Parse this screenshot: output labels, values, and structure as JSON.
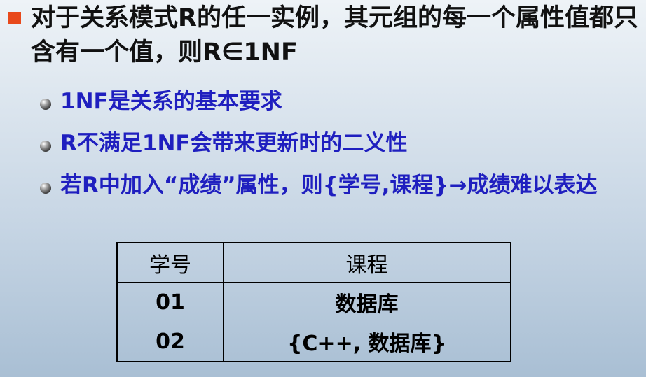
{
  "main_point": "对于关系模式R的任一实例，其元组的每一个属性值都只含有一个值，则R∈1NF",
  "sub_points": [
    "1NF是关系的基本要求",
    "R不满足1NF会带来更新时的二义性",
    "若R中加入“成绩”属性，则{学号,课程}→成绩难以表达"
  ],
  "table": {
    "headers": [
      "学号",
      "课程"
    ],
    "rows": [
      [
        "01",
        "数据库"
      ],
      [
        "02",
        "{C++, 数据库}"
      ]
    ]
  },
  "colors": {
    "main_bullet": "#e8491b",
    "main_text": "#111111",
    "sub_text": "#1f1fbf"
  }
}
